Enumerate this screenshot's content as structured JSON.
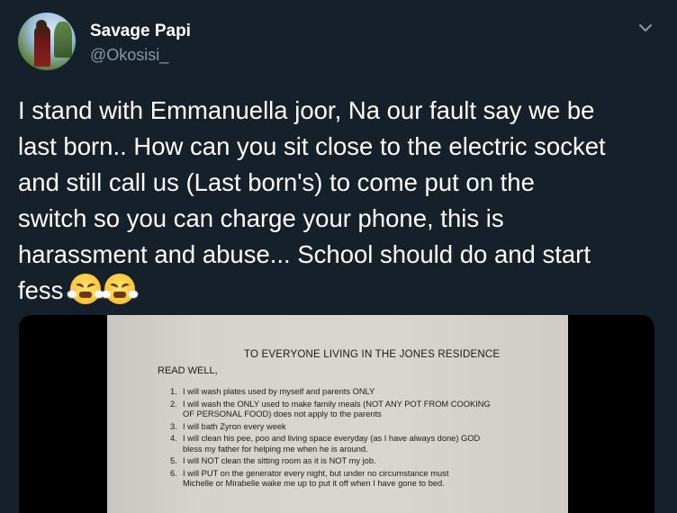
{
  "user": {
    "display_name": "Savage Papi",
    "handle": "@Okosisi_"
  },
  "icons": {
    "more": "chevron-down-icon",
    "emoji": "face-with-steam-from-nose"
  },
  "tweet": {
    "text": "I stand with Emmanuella joor, Na our fault say we be\nlast born.. How can you sit close to the electric socket\nand still call us (Last born's) to come put on the\nswitch so you can charge your phone, this is\nharassment and abuse... School should do and start\nfess",
    "emoji_count": 2
  },
  "media": {
    "title": "TO EVERYONE LIVING IN THE JONES RESIDENCE",
    "read_well": "READ WELL,",
    "items": [
      {
        "num": "1.",
        "lines": [
          "I will wash plates used by myself and parents ONLY"
        ]
      },
      {
        "num": "2.",
        "lines": [
          "I will wash the ONLY used to make family meals (NOT ANY POT FROM COOKING",
          "OF PERSONAL FOOD) does not apply to the parents"
        ]
      },
      {
        "num": "3.",
        "lines": [
          "I will bath Zyron every week"
        ]
      },
      {
        "num": "4.",
        "lines": [
          "I will clean his pee, poo and living space everyday (as I have always done) GOD",
          "bless my father for helping me when he is around."
        ]
      },
      {
        "num": "5.",
        "lines": [
          "I will NOT clean the sitting room as it is NOT my job."
        ]
      },
      {
        "num": "6.",
        "lines": [
          "I will PUT on the generator every night, but under no circumstance must",
          "Michelle or Mirabelle wake me up to put it off when I have gone to bed."
        ]
      }
    ]
  },
  "colors": {
    "background": "#15202b",
    "text": "#ffffff",
    "secondary_text": "#8899a6"
  }
}
